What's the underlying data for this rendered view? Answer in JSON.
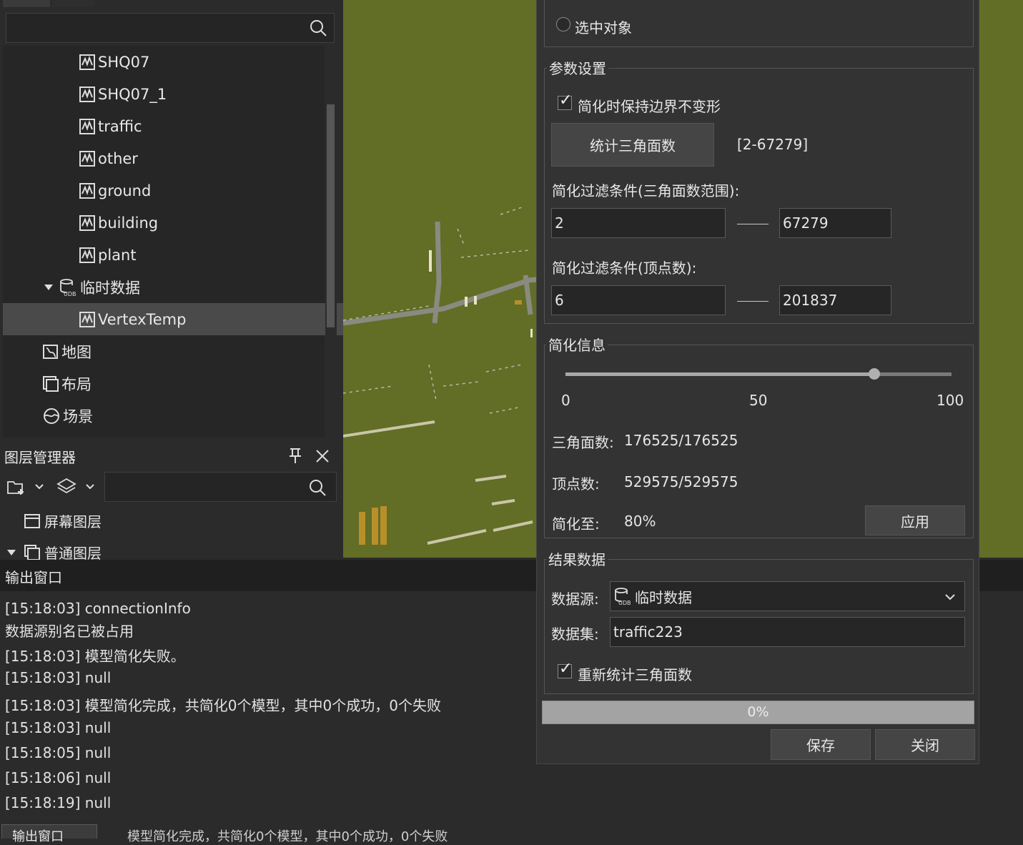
{
  "workspace_tree": {
    "items": [
      {
        "label": "SHQ07",
        "icon": "dataset-model-icon"
      },
      {
        "label": "SHQ07_1",
        "icon": "dataset-model-icon"
      },
      {
        "label": "traffic",
        "icon": "dataset-model-icon"
      },
      {
        "label": "other",
        "icon": "dataset-model-icon"
      },
      {
        "label": "ground",
        "icon": "dataset-model-icon"
      },
      {
        "label": "building",
        "icon": "dataset-model-icon"
      },
      {
        "label": "plant",
        "icon": "dataset-model-icon"
      },
      {
        "label": "临时数据",
        "icon": "udb-datasource-icon"
      },
      {
        "label": "VertexTemp",
        "icon": "dataset-model-icon",
        "selected": true
      },
      {
        "label": "地图",
        "icon": "map-icon"
      },
      {
        "label": "布局",
        "icon": "layout-icon"
      },
      {
        "label": "场景",
        "icon": "scene-icon"
      }
    ]
  },
  "layer_manager": {
    "title": "图层管理器",
    "items": [
      {
        "label": "屏幕图层"
      },
      {
        "label": "普通图层"
      }
    ]
  },
  "output": {
    "title": "输出窗口",
    "lines": [
      "[15:18:03] connectionInfo",
      "数据源别名已被占用",
      "[15:18:03] 模型简化失败。",
      "[15:18:03] null",
      "[15:18:03] 模型简化完成，共简化0个模型，其中0个成功，0个失败",
      "[15:18:03] null",
      "[15:18:05] null",
      "[15:18:06] null",
      "[15:18:19] null"
    ],
    "bottom_tab": "输出窗口",
    "status": "模型简化完成，共简化0个模型，其中0个成功，0个失败"
  },
  "dialog": {
    "selected_object": "选中对象",
    "params": {
      "title": "参数设置",
      "keep_boundary": "简化时保持边界不变形",
      "count_button": "统计三角面数",
      "count_range": "[2-67279]",
      "filter_triangles_label": "简化过滤条件(三角面数范围):",
      "tri_min": "2",
      "tri_max": "67279",
      "filter_vertex_label": "简化过滤条件(顶点数):",
      "vert_min": "6",
      "vert_max": "201837"
    },
    "info": {
      "title": "简化信息",
      "slider_value": 80,
      "tick_min": "0",
      "tick_mid": "50",
      "tick_max": "100",
      "triangles_label": "三角面数:",
      "triangles_value": "176525/176525",
      "vertices_label": "顶点数:",
      "vertices_value": "529575/529575",
      "simplify_label": "简化至:",
      "simplify_value": "80%",
      "apply_button": "应用"
    },
    "result": {
      "title": "结果数据",
      "datasource_label": "数据源:",
      "datasource_value": "临时数据",
      "dataset_label": "数据集:",
      "dataset_value": "traffic223",
      "recount": "重新统计三角面数"
    },
    "progress": {
      "value": 0,
      "text": "0%"
    },
    "save_button": "保存",
    "close_button": "关闭"
  }
}
